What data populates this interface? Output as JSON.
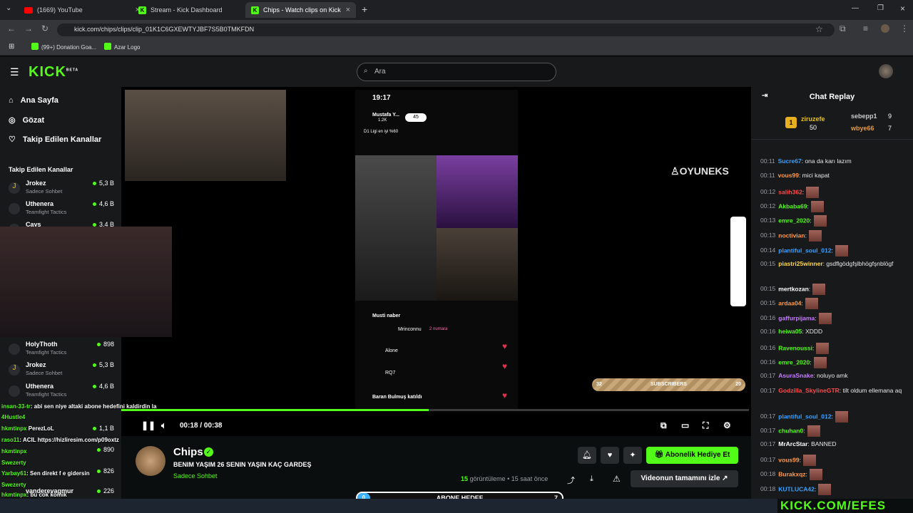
{
  "browser": {
    "tabs": [
      {
        "title": "(1669) YouTube",
        "icon": "youtube-icon"
      },
      {
        "title": "Stream - Kick Dashboard",
        "icon": "kick-icon"
      },
      {
        "title": "Chips - Watch clips on Kick",
        "icon": "kick-icon"
      }
    ],
    "url": "kick.com/chips/clips/clip_01K1C6GXEWTYJBF7S5B0TMKFDN",
    "bookmarks": [
      "(99+) Donation Goa...",
      "Azar Logo"
    ]
  },
  "header": {
    "logo": "KICK",
    "beta": "BETA",
    "search_placeholder": "Ara"
  },
  "sidebar": {
    "nav": [
      {
        "label": "Ana Sayfa",
        "icon": "home-icon"
      },
      {
        "label": "Gözat",
        "icon": "compass-icon"
      },
      {
        "label": "Takip Edilen Kanallar",
        "icon": "heart-icon"
      }
    ],
    "section_title": "Takip Edilen Kanallar",
    "channels_top": [
      {
        "name": "Jrokez",
        "category": "Sadece Sohbet",
        "count": "5,3 B"
      },
      {
        "name": "Uthenera",
        "category": "Teamfight Tactics",
        "count": "4,6 B"
      },
      {
        "name": "Cays",
        "category": "",
        "count": "3,4 B"
      }
    ],
    "channels_bottom": [
      {
        "name": "HolyThoth",
        "category": "Teamfight Tactics",
        "count": "898"
      },
      {
        "name": "Jrokez",
        "category": "Sadece Sohbet",
        "count": "5,3 B"
      },
      {
        "name": "Uthenera",
        "category": "Teamfight Tactics",
        "count": "4,6 B"
      },
      {
        "name": "hkmtinpx",
        "category": "",
        "count": "1,1 B"
      },
      {
        "name": "raso11",
        "category": "",
        "count": "890"
      },
      {
        "name": "Swezerty",
        "category": "",
        "count": "826"
      },
      {
        "name": "vanderevagmur",
        "category": "",
        "count": "226"
      }
    ]
  },
  "overlay_chat": [
    {
      "user": "insan-33-tr",
      "text": ": abi sen niye altaki abone hedefini kaldirdin la"
    },
    {
      "user": "4Hustle4",
      "text": ""
    },
    {
      "user": "hkmtinpx",
      "text": "PerezLoL"
    },
    {
      "user": "raso11",
      "text": ": ACIL https://hizliresim.com/p09oxtz"
    },
    {
      "user": "hkmtinpx",
      "text": ""
    },
    {
      "user": "Swezerty",
      "text": ""
    },
    {
      "user": "Yarbay61",
      "text": ": Sen direkt f e gidersin"
    },
    {
      "user": "Swezerty",
      "text": ""
    },
    {
      "user": "hkmtinpx",
      "text": ": bu cok komik"
    }
  ],
  "stream_overlay": {
    "brand": "OYUNEKS",
    "subscribers_label": "SUBSCRIBERS",
    "sub_left": "32",
    "sub_right": "20"
  },
  "phone": {
    "time": "19:17",
    "user": "Mustafa Y...",
    "followers": "1.2K",
    "score": "45",
    "league": "D1 Ligi en iyi %60",
    "host_msg": "Musti naber",
    "comments": [
      {
        "user": "Mrinconnu",
        "badge": "2 numara"
      },
      {
        "user": "Alone",
        "badge": ""
      },
      {
        "user": "RQ7",
        "badge": ""
      },
      {
        "user": "Baran Bulmuş katıldı",
        "badge": ""
      }
    ]
  },
  "player": {
    "progress": 0.49,
    "current": "00:18",
    "duration": "00:38"
  },
  "stream": {
    "channel": "Chips",
    "title": "BENIM YAŞIM 26 SENIN YAŞIN KAÇ GARDEŞ",
    "category": "Sadece Sohbet",
    "views": "15",
    "views_label": "görüntüleme",
    "ago": "15 saat önce",
    "gift_label": "Abonelik Hediye Et",
    "watch_full_label": "Videonun tamamını izle"
  },
  "goal": {
    "left": "0",
    "label": "ABONE HEDEF",
    "right": "7"
  },
  "chat": {
    "title": "Chat Replay",
    "leaders": [
      {
        "rank": "1",
        "name": "ziruzefe",
        "value": "50"
      },
      {
        "name": "sebepp1",
        "value": "9"
      },
      {
        "name": "wbye66",
        "value": "7"
      }
    ],
    "messages": [
      {
        "time": "00:11",
        "user": "Sucre67",
        "color": "#3ba1ff",
        "text": ": ona da karı lazım",
        "emote": false
      },
      {
        "time": "00:11",
        "user": "vous99",
        "color": "#ff9b4a",
        "text": ": mici kapat",
        "emote": false
      },
      {
        "time": "00:12",
        "user": "salih362",
        "color": "#ff4a4a",
        "text": ":",
        "emote": true
      },
      {
        "time": "00:12",
        "user": "Akbaba69",
        "color": "#53fc18",
        "text": ":",
        "emote": true
      },
      {
        "time": "00:13",
        "user": "emre_2020",
        "color": "#53fc18",
        "text": ":",
        "emote": true
      },
      {
        "time": "00:13",
        "user": "noctivian",
        "color": "#ff9b4a",
        "text": ":",
        "emote": true
      },
      {
        "time": "00:14",
        "user": "plantiful_soul_012",
        "color": "#3ba1ff",
        "text": ":",
        "emote": true
      },
      {
        "time": "00:15",
        "user": "piastri25winner",
        "color": "#ffd84a",
        "text": ": gsdflgödgfşlbhögfşnblögf",
        "emote": false
      },
      {
        "time": "00:15",
        "user": "mertkozan",
        "color": "#ffffff",
        "text": ":",
        "emote": true
      },
      {
        "time": "00:15",
        "user": "ardaa04",
        "color": "#ff9b4a",
        "text": ":",
        "emote": true
      },
      {
        "time": "00:16",
        "user": "gaffurpijama",
        "color": "#c77dff",
        "text": ":",
        "emote": true
      },
      {
        "time": "00:16",
        "user": "heiwa05",
        "color": "#53fc18",
        "text": ": XDDD",
        "emote": false
      },
      {
        "time": "00:16",
        "user": "Ravenoussi",
        "color": "#53fc18",
        "text": ":",
        "emote": true
      },
      {
        "time": "00:16",
        "user": "emre_2020",
        "color": "#53fc18",
        "text": ":",
        "emote": true
      },
      {
        "time": "00:17",
        "user": "AsuraSnake",
        "color": "#c77dff",
        "text": ": noluyo amk",
        "emote": false
      },
      {
        "time": "00:17",
        "user": "Godzilla_SkylineGTR",
        "color": "#ff4a4a",
        "text": ": tilt oldum ellemana aq",
        "emote": false
      },
      {
        "time": "00:17",
        "user": "plantiful_soul_012",
        "color": "#3ba1ff",
        "text": ":",
        "emote": true
      },
      {
        "time": "00:17",
        "user": "chuhan0",
        "color": "#53fc18",
        "text": ":",
        "emote": true
      },
      {
        "time": "00:17",
        "user": "MrArcStar",
        "color": "#ffffff",
        "text": ": BANNED",
        "emote": false
      },
      {
        "time": "00:17",
        "user": "vous99",
        "color": "#ff9b4a",
        "text": ":",
        "emote": true
      },
      {
        "time": "00:18",
        "user": "Burakxqz",
        "color": "#ff9b4a",
        "text": ":",
        "emote": true
      },
      {
        "time": "00:18",
        "user": "KUTLUCA42",
        "color": "#3ba1ff",
        "text": ":",
        "emote": true
      }
    ]
  },
  "watermark": "KICK.COM/EFES"
}
